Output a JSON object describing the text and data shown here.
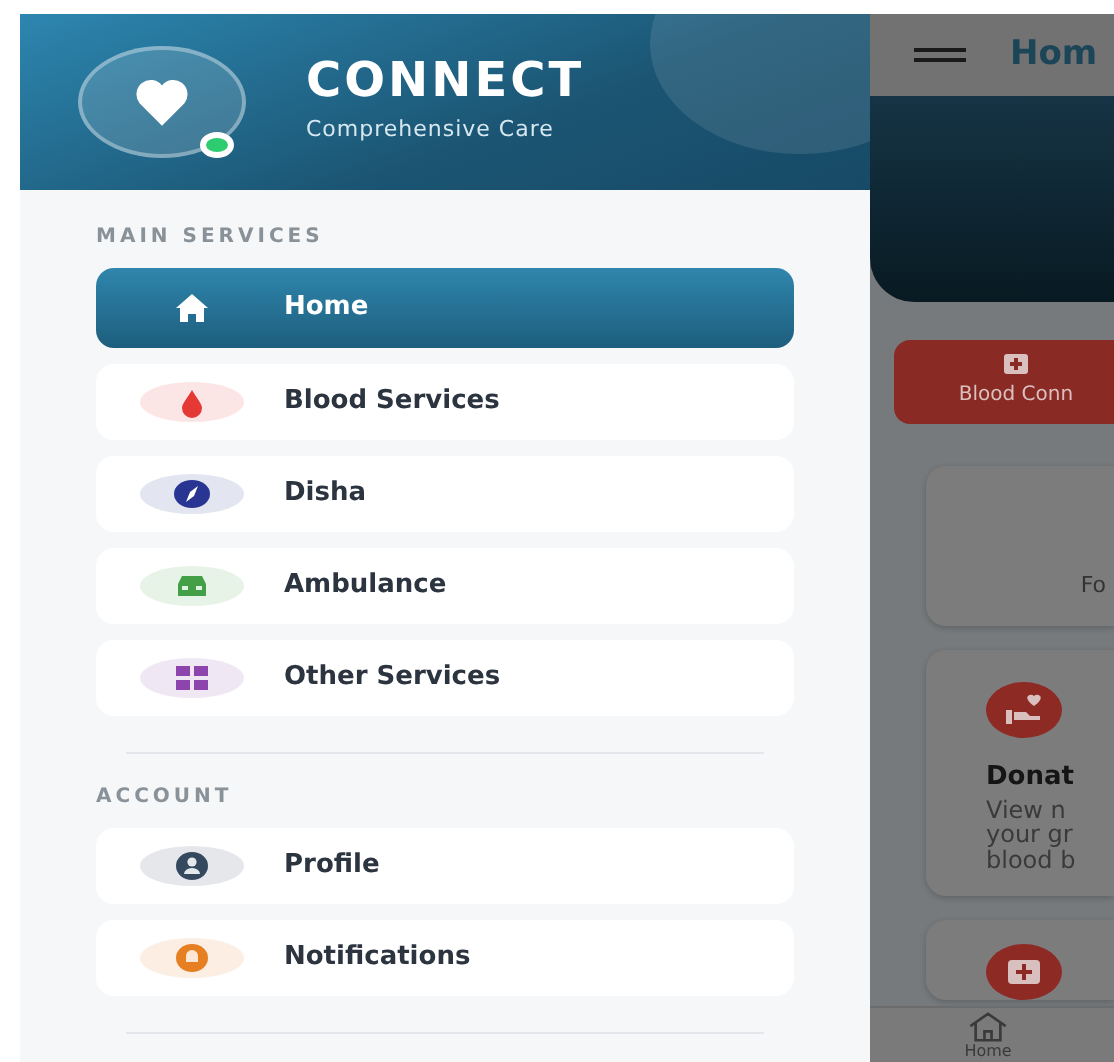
{
  "drawer": {
    "brand": {
      "title": "CONNECT",
      "subtitle": "Comprehensive Care",
      "online": true
    },
    "sections": [
      {
        "heading": "MAIN SERVICES",
        "items": [
          {
            "label": "Home",
            "kind": "home",
            "color": "#ffffff",
            "selected": true
          },
          {
            "label": "Blood Services",
            "kind": "drop",
            "color": "#e53935",
            "selected": false
          },
          {
            "label": "Disha",
            "kind": "compass",
            "color": "#283593",
            "selected": false
          },
          {
            "label": "Ambulance",
            "kind": "car",
            "color": "#43a047",
            "selected": false
          },
          {
            "label": "Other Services",
            "kind": "grid",
            "color": "#8e44ad",
            "selected": false
          }
        ]
      },
      {
        "heading": "ACCOUNT",
        "items": [
          {
            "label": "Profile",
            "kind": "person",
            "color": "#34495e",
            "selected": false
          },
          {
            "label": "Notifications",
            "kind": "bell",
            "color": "#e67e22",
            "selected": false
          }
        ]
      }
    ]
  },
  "main": {
    "app_bar_title": "Hom",
    "quick_button": "Blood Conn",
    "card_1_text": "Fo",
    "card_2": {
      "title": "Donat",
      "lines": [
        "View n",
        "your gr",
        "blood b"
      ]
    },
    "bottom_nav": [
      {
        "label": "Home"
      }
    ]
  }
}
